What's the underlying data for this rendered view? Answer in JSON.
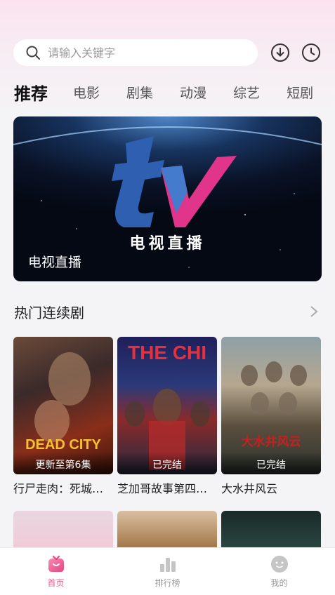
{
  "search": {
    "placeholder": "请输入关键字"
  },
  "header": {
    "download_icon": "download-icon",
    "history_icon": "history-clock-icon"
  },
  "tabs": [
    {
      "label": "推荐",
      "active": true
    },
    {
      "label": "电影"
    },
    {
      "label": "剧集"
    },
    {
      "label": "动漫"
    },
    {
      "label": "综艺"
    },
    {
      "label": "短剧"
    }
  ],
  "banner": {
    "logo_text": "电视直播",
    "title": "电视直播"
  },
  "section": {
    "title": "热门连续剧"
  },
  "cards": [
    {
      "name": "行尸走肉：死城…",
      "badge": "更新至第6集",
      "poster_text": "DEAD CITY"
    },
    {
      "name": "芝加哥故事第四…",
      "badge": "已完结",
      "poster_text": "THE CHI"
    },
    {
      "name": "大水井风云",
      "badge": "已完结",
      "poster_text": "大水井风云"
    }
  ],
  "nav": [
    {
      "label": "首页",
      "icon": "home-icon",
      "active": true
    },
    {
      "label": "排行榜",
      "icon": "ranking-bar-icon"
    },
    {
      "label": "我的",
      "icon": "profile-face-icon"
    }
  ],
  "colors": {
    "accent": "#ee5890",
    "background": "#f4f4f6"
  }
}
